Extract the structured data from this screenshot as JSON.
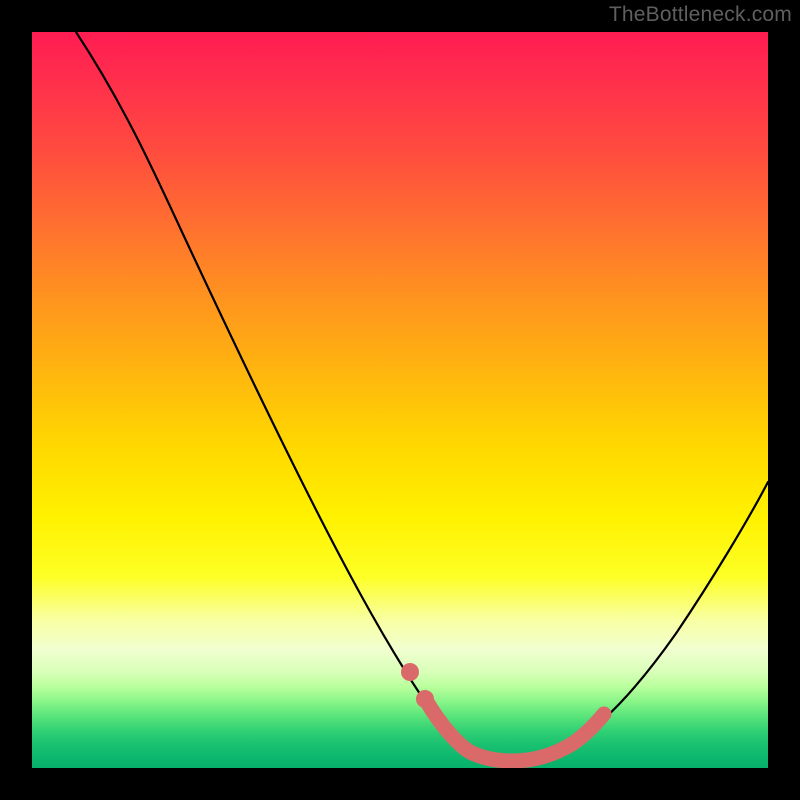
{
  "attribution": "TheBottleneck.com",
  "colors": {
    "curve_black": "#000000",
    "highlight_salmon": "#d96a69",
    "frame_black": "#000000"
  },
  "chart_data": {
    "type": "line",
    "title": "",
    "xlabel": "",
    "ylabel": "",
    "xlim": [
      0,
      100
    ],
    "ylim": [
      0,
      100
    ],
    "grid": false,
    "legend": false,
    "series": [
      {
        "name": "bottleneck-curve",
        "x": [
          6,
          10,
          14,
          18,
          22,
          26,
          30,
          34,
          38,
          42,
          46,
          50,
          52,
          54,
          56,
          58,
          60,
          62,
          64,
          66,
          68,
          70,
          74,
          78,
          82,
          86,
          90,
          94,
          98,
          100
        ],
        "y": [
          100,
          92,
          84,
          77,
          69,
          61,
          53,
          45,
          37,
          29,
          22,
          14,
          11,
          8,
          6,
          4,
          3,
          2,
          2,
          2,
          2,
          3,
          6,
          11,
          17,
          24,
          31,
          38,
          45,
          49
        ]
      },
      {
        "name": "optimum-highlight",
        "x": [
          52,
          54,
          56,
          58,
          60,
          62,
          64,
          66,
          68,
          70,
          72,
          74
        ],
        "y": [
          11,
          8,
          6,
          4,
          3,
          2,
          2,
          2,
          2,
          3,
          4,
          6
        ]
      }
    ],
    "annotations": []
  }
}
